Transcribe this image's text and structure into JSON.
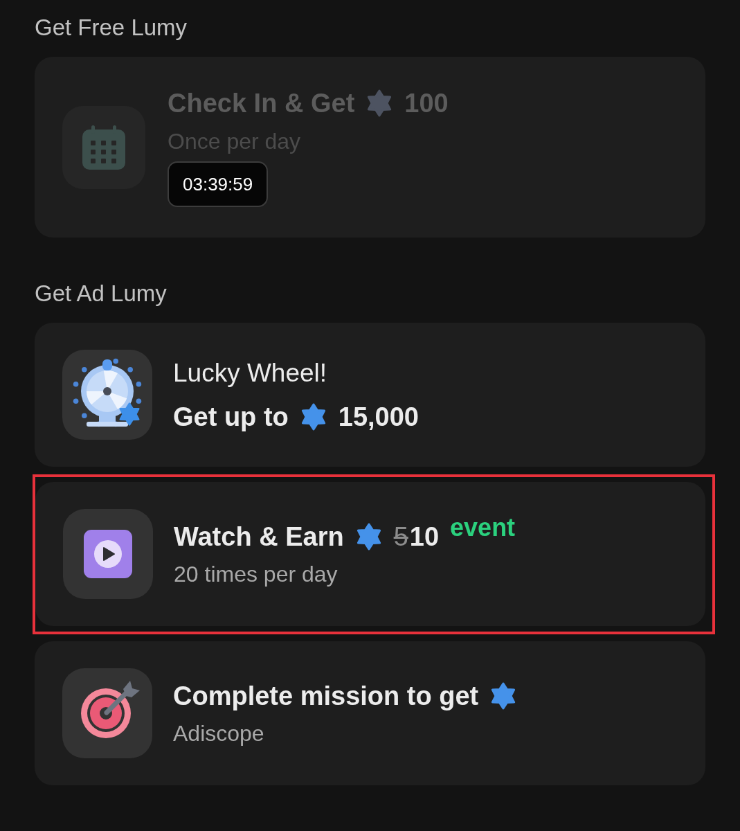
{
  "sections": [
    {
      "title": "Get Free Lumy",
      "cards": [
        {
          "kind": "checkin",
          "disabled": true,
          "highlighted": false,
          "title": "Check In & Get",
          "amount": "100",
          "subtitle": "Once per day",
          "timer": "03:39:59"
        }
      ]
    },
    {
      "title": "Get Ad Lumy",
      "cards": [
        {
          "kind": "wheel",
          "disabled": false,
          "highlighted": false,
          "caption": "Lucky Wheel!",
          "title": "Get up to",
          "amount": "15,000"
        },
        {
          "kind": "watch",
          "disabled": false,
          "highlighted": true,
          "title": "Watch & Earn",
          "old_amount": "5",
          "amount": "10",
          "tag": "event",
          "subtitle": "20 times per day"
        },
        {
          "kind": "mission",
          "disabled": false,
          "highlighted": false,
          "title": "Complete mission to get",
          "subtitle": "Adiscope"
        }
      ]
    }
  ]
}
